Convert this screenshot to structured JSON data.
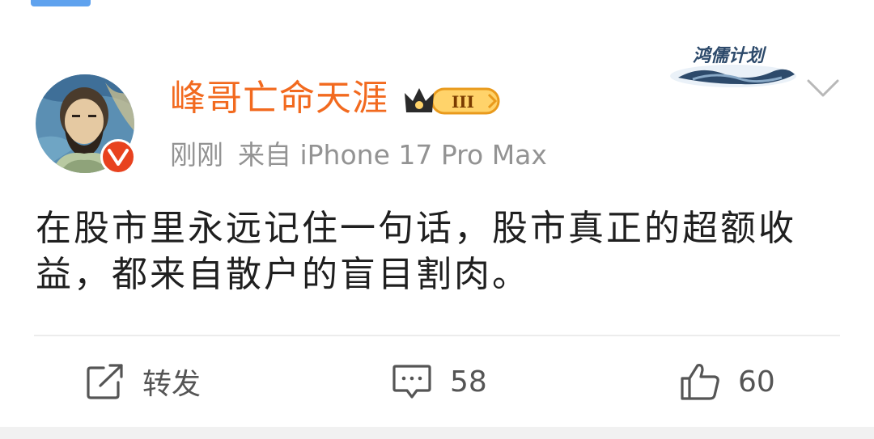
{
  "post": {
    "username": "峰哥亡命天涯",
    "vip_level": "III",
    "time": "刚刚",
    "source": "来自 iPhone 17 Pro Max",
    "content": "在股市里永远记住一句话，股市真正的超额收益，都来自散户的盲目割肉。",
    "banner_text": "鸿儒计划"
  },
  "actions": {
    "repost_label": "转发",
    "comment_count": "58",
    "like_count": "60"
  },
  "colors": {
    "username": "#f26a1f",
    "verified_badge": "#e8421f",
    "meta_text": "#939393",
    "content_text": "#1f1f1f",
    "action_text": "#555555"
  },
  "icons": {
    "top_tab": "tab-indicator",
    "verified": "verified-v-icon",
    "vip": "crown-icon",
    "more": "chevron-down-icon",
    "repost": "share-edit-icon",
    "comment": "comment-icon",
    "like": "thumbs-up-icon"
  }
}
